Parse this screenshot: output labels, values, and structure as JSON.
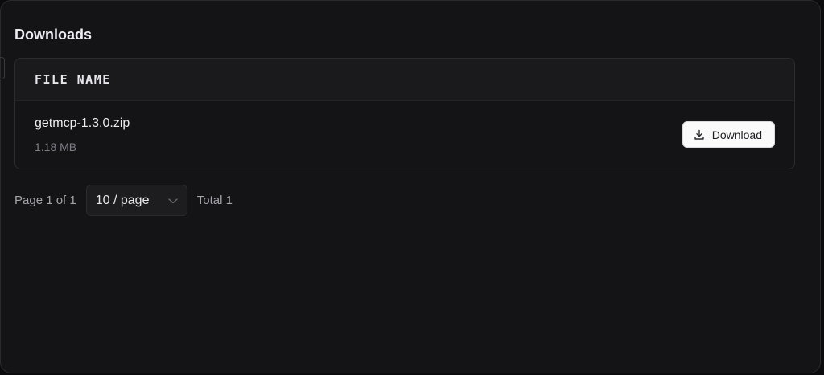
{
  "downloads": {
    "title": "Downloads",
    "table": {
      "column_header": "FILE NAME",
      "rows": [
        {
          "file_name": "getmcp-1.3.0.zip",
          "file_size": "1.18 MB",
          "action_label": "Download",
          "action_icon": "download-icon"
        }
      ]
    },
    "pagination": {
      "page_info": "Page 1 of 1",
      "page_size": "10 / page",
      "page_size_icon": "chevron-down-icon",
      "total": "Total 1"
    }
  },
  "colors": {
    "panel_bg": "#141417",
    "header_bg": "#1a1a1d",
    "button_bg": "#fafafa",
    "text_primary": "#ececf1",
    "text_muted": "#7f7f87"
  }
}
